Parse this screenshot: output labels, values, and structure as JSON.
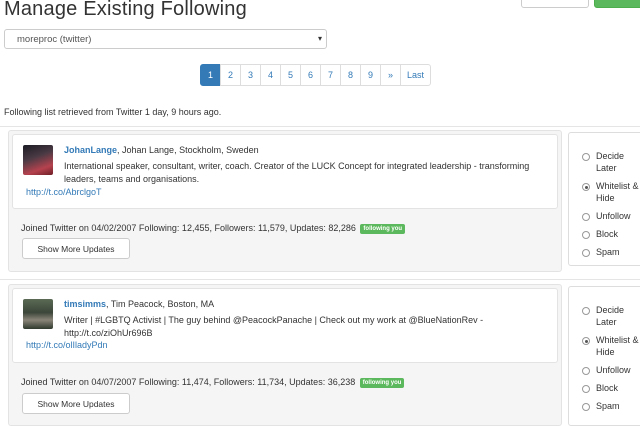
{
  "page": {
    "title": "Manage Existing Following"
  },
  "account_select": {
    "value": "moreproc (twitter)",
    "caret": "▾"
  },
  "pagination": {
    "pages": [
      "1",
      "2",
      "3",
      "4",
      "5",
      "6",
      "7",
      "8",
      "9"
    ],
    "active": "1",
    "next": "»",
    "last": "Last"
  },
  "status_text": "Following list retrieved from Twitter 1 day, 9 hours ago.",
  "users": [
    {
      "username": "JohanLange",
      "details": ", Johan Lange, Stockholm, Sweden",
      "bio": "International speaker, consultant, writer, coach. Creator of the LUCK Concept for integrated leadership - transforming leaders, teams and organisations.",
      "link": "http://t.co/AbrclgoT",
      "stats": "Joined Twitter on 04/02/2007 Following: 12,455, Followers: 11,579, Updates: 82,286",
      "badge": "following you",
      "more_button": "Show More Updates",
      "options": [
        "Decide Later",
        "Whitelist & Hide",
        "Unfollow",
        "Block",
        "Spam"
      ],
      "selected_option": "Whitelist & Hide"
    },
    {
      "username": "timsimms",
      "details": ", Tim Peacock, Boston, MA",
      "bio": "Writer | #LGBTQ Activist | The guy behind @PeacockPanache | Check out my work at @BlueNationRev - http://t.co/ziOhUr696B",
      "link": "http://t.co/olIladyPdn",
      "stats": "Joined Twitter on 04/07/2007 Following: 11,474, Followers: 11,734, Updates: 36,238",
      "badge": "following you",
      "more_button": "Show More Updates",
      "options": [
        "Decide Later",
        "Whitelist & Hide",
        "Unfollow",
        "Block",
        "Spam"
      ],
      "selected_option": "Whitelist & Hide"
    }
  ]
}
